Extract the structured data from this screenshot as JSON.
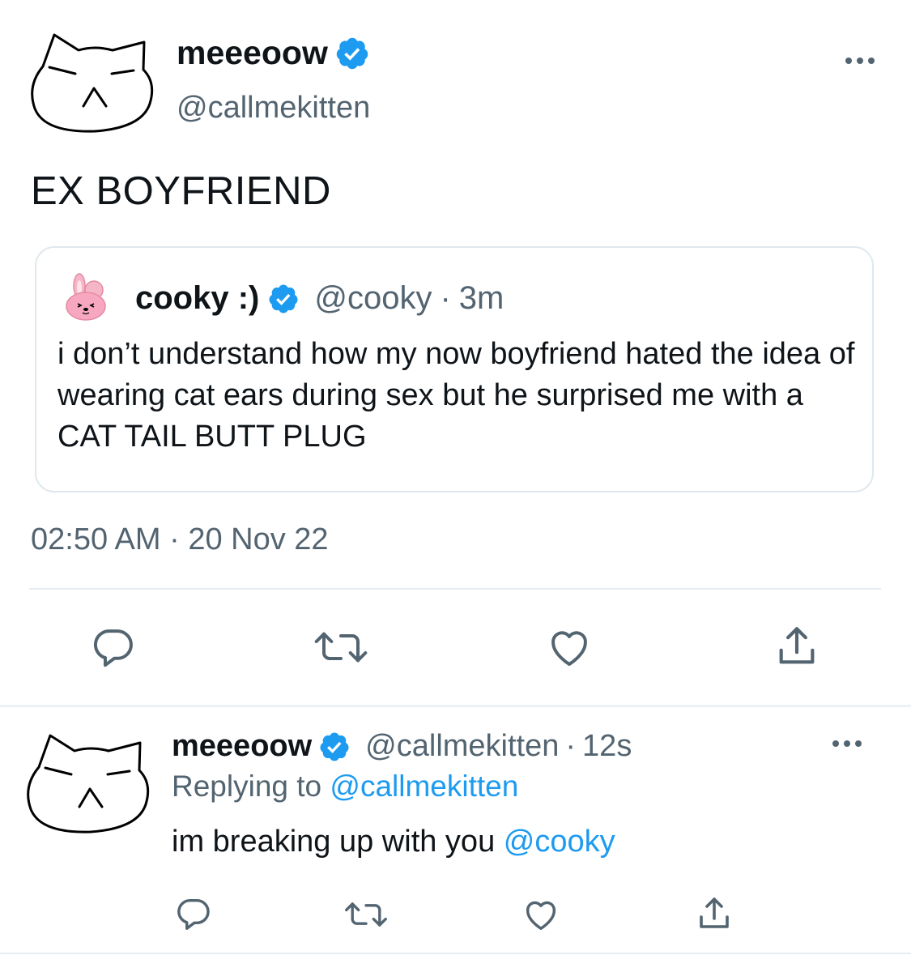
{
  "main_tweet": {
    "display_name": "meeeoow",
    "handle": "@callmekitten",
    "text": "EX BOYFRIEND",
    "timestamp": "02:50 AM · 20 Nov 22",
    "quoted": {
      "display_name": "cooky :)",
      "handle": "@cooky",
      "separator": "·",
      "time": "3m",
      "text": "i don’t understand how my now boyfriend hated the idea of wearing cat ears during sex but he surprised me with a CAT TAIL BUTT PLUG"
    }
  },
  "reply": {
    "display_name": "meeeoow",
    "handle": "@callmekitten",
    "separator": "·",
    "time": "12s",
    "replying_label": "Replying to",
    "replying_handle": "@callmekitten",
    "text": "im breaking up with you",
    "mention": "@cooky"
  },
  "icons": {
    "reply": "comment-icon",
    "retweet": "retweet-icon",
    "like": "heart-icon",
    "share": "share-icon",
    "more": "more-icon",
    "verified": "verified-badge-icon"
  },
  "colors": {
    "accent": "#1d9bf0",
    "text": "#0f1419",
    "secondary": "#536471",
    "divider": "#e6ecf0"
  }
}
